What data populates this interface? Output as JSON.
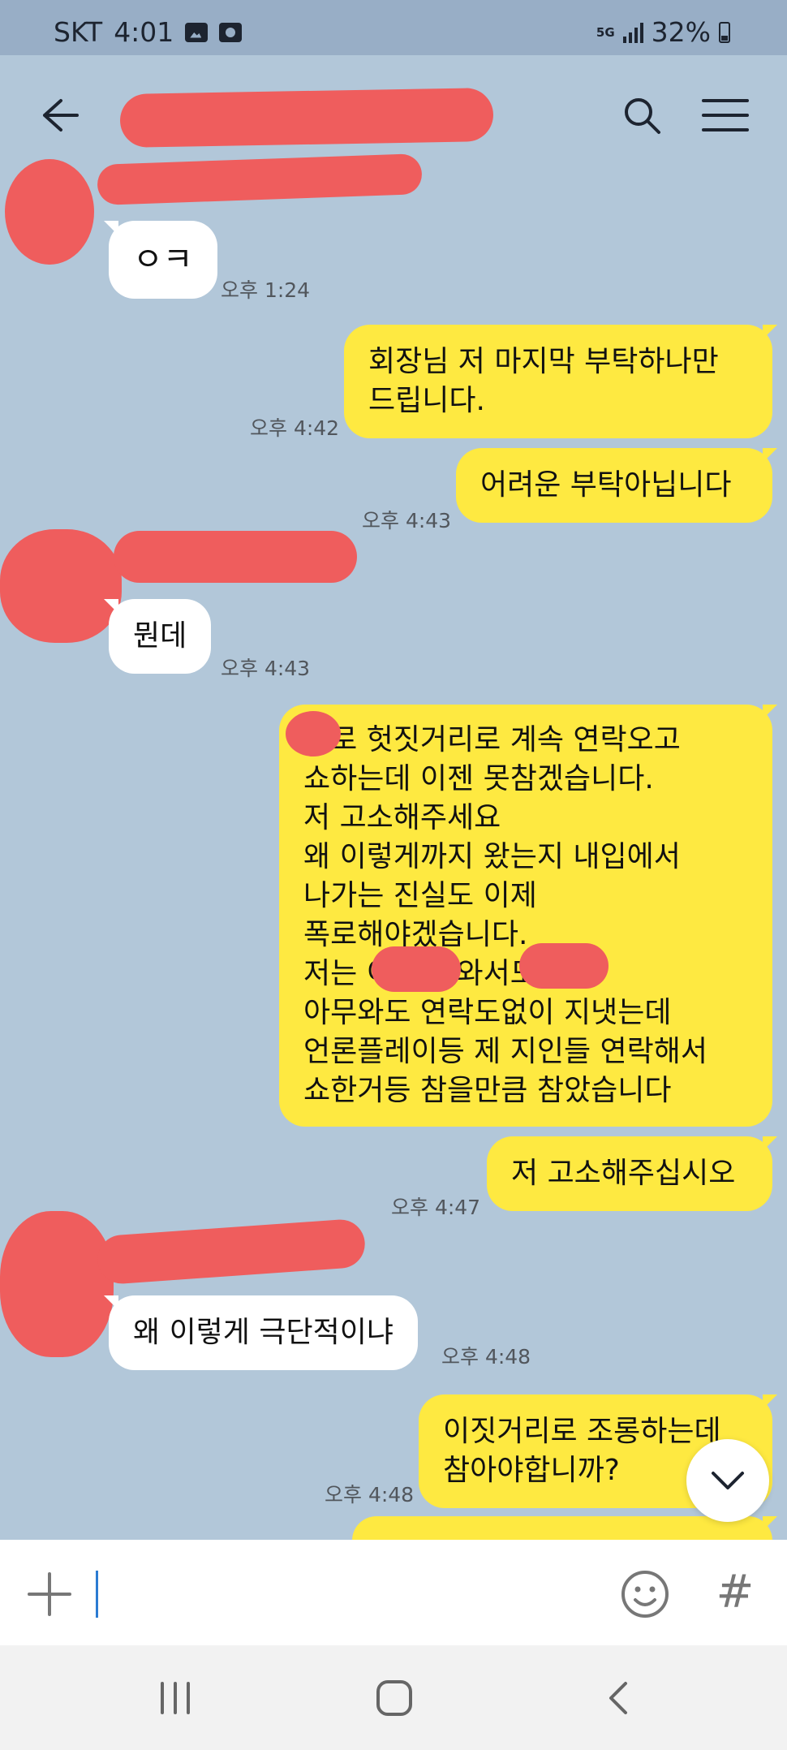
{
  "status_bar": {
    "carrier": "SKT",
    "time": "4:01",
    "network": "5G",
    "battery": "32%",
    "battery_level": 0.32,
    "icons": [
      "image-icon",
      "record-icon",
      "signal-icon",
      "battery-icon"
    ]
  },
  "header": {
    "chat_title": "",
    "icons": [
      "back-arrow-icon",
      "search-icon",
      "menu-icon"
    ]
  },
  "messages": [
    {
      "side": "in",
      "text": "ㅇㅋ",
      "time": "오후 1:24"
    },
    {
      "side": "out",
      "text": "회장님 저 마지막 부탁하나만\n드립니다.",
      "time": "오후 4:42"
    },
    {
      "side": "out",
      "text": "어려운 부탁아닙니다",
      "time": "오후 4:43"
    },
    {
      "side": "in",
      "text": "뭔데",
      "time": "오후 4:43"
    },
    {
      "side": "out",
      "text": "프로 헛짓거리로 계속 연락오고\n쇼하는데 이젠 못참겠습니다.\n저 고소해주세요\n왜 이렇게까지 왔는지 내입에서\n나가는 진실도 이제\n폭로해야겠습니다.\n저는 이나 나와서도\n아무와도 연락도없이 지냇는데\n언론플레이등 제 지인들 연락해서\n쇼한거등 참을만큼 참았습니다",
      "time": ""
    },
    {
      "side": "out",
      "text": "저 고소해주십시오",
      "time": "오후 4:47"
    },
    {
      "side": "in",
      "text": "왜 이렇게 극단적이냐",
      "time": "오후 4:48"
    },
    {
      "side": "out",
      "text": "이짓거리로 조롱하는데\n참아야합니까?",
      "time": "오후 4:48"
    }
  ],
  "input_bar": {
    "placeholder": "",
    "value": "",
    "icons": [
      "plus-icon",
      "emoji-icon",
      "hashtag-icon"
    ],
    "hash_label": "#"
  },
  "nav_bar": {
    "icons": [
      "recent-apps-icon",
      "home-icon",
      "back-icon"
    ]
  },
  "colors": {
    "chat_background": "#b2c7d9",
    "status_bar": "#98aec6",
    "outgoing_bubble": "#fee941",
    "incoming_bubble": "#ffffff",
    "redaction": "#ef5d5d"
  }
}
